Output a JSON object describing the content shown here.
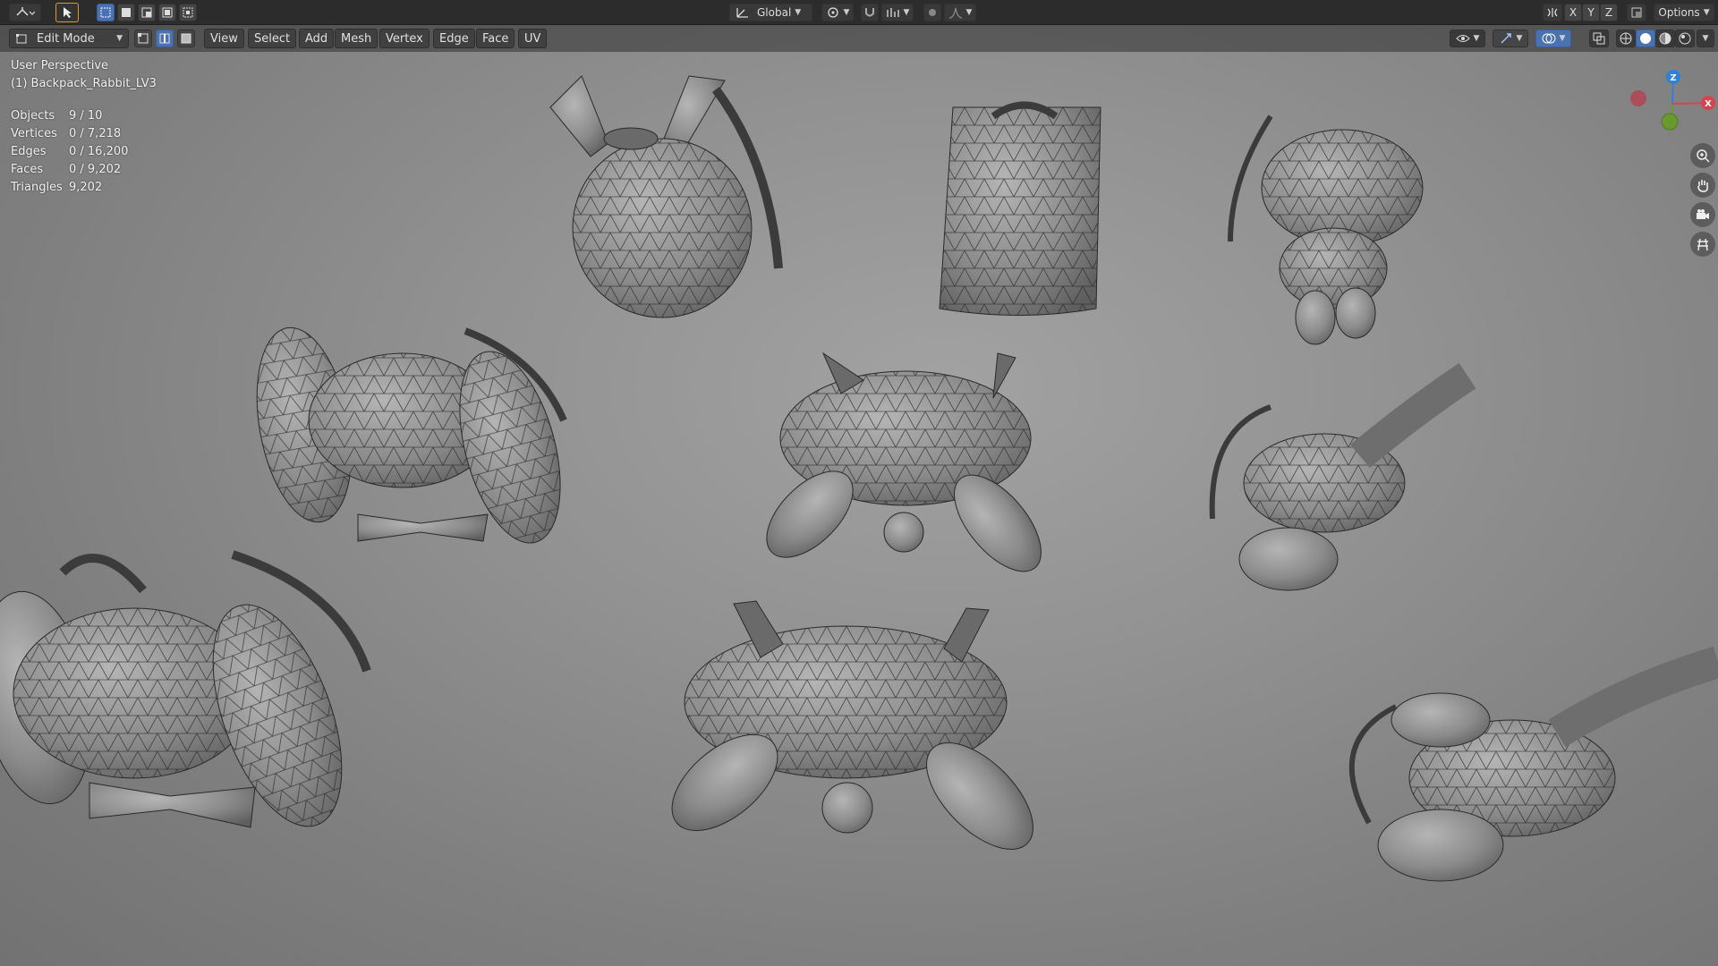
{
  "topbar": {
    "orientation_label": "Global",
    "axis_x": "X",
    "axis_y": "Y",
    "axis_z": "Z",
    "options_label": "Options"
  },
  "header": {
    "mode_label": "Edit Mode",
    "menus": {
      "view": "View",
      "select": "Select",
      "add": "Add",
      "mesh": "Mesh",
      "vertex": "Vertex",
      "edge": "Edge",
      "face": "Face",
      "uv": "UV"
    }
  },
  "viewport_info": {
    "perspective": "User Perspective",
    "object_name": "(1) Backpack_Rabbit_LV3"
  },
  "stats": {
    "objects_label": "Objects",
    "objects_value": "9 / 10",
    "vertices_label": "Vertices",
    "vertices_value": "0 / 7,218",
    "edges_label": "Edges",
    "edges_value": "0 / 16,200",
    "faces_label": "Faces",
    "faces_value": "0 / 9,202",
    "triangles_label": "Triangles",
    "triangles_value": "9,202"
  },
  "gizmo": {
    "z_label": "Z",
    "x_label": "X",
    "colors": {
      "x": "#d7434f",
      "y": "#6a9a2f",
      "z": "#2f7fdc"
    }
  },
  "icons": {
    "editor_type": "view3d-icon",
    "select_tool": "cursor-icon",
    "zoom": "zoom-icon",
    "pan": "hand-icon",
    "camera": "camera-icon",
    "ortho": "grid-icon"
  },
  "colors": {
    "accent": "#4a72b0",
    "mesh_fill": "#8a8a8a",
    "wire": "#2a2a2a"
  }
}
